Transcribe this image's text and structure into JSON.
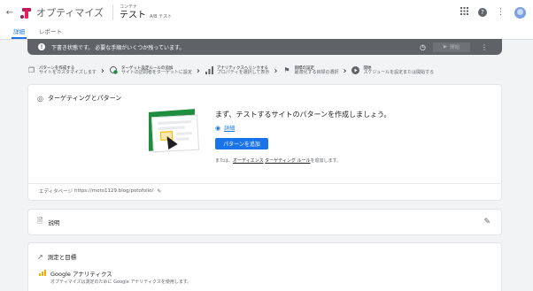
{
  "header": {
    "brand": "オプティマイズ",
    "container_label": "コンテナ",
    "container_name": "テスト",
    "experiment_type": "A/B テスト"
  },
  "tabs": [
    {
      "label": "詳細",
      "active": true
    },
    {
      "label": "レポート",
      "active": false
    }
  ],
  "banner": {
    "text": "下書き状態です。 必要な手順がいくつか残っています。",
    "start_label": "開始"
  },
  "steps": [
    {
      "title": "パターンを作成する",
      "subtitle": "サイトをカスタマイズします",
      "icon": "copy-icon"
    },
    {
      "title": "ターゲット設定ルールの追加",
      "subtitle": "サイトの訪問者をターゲットに設定",
      "icon": "target-check-icon"
    },
    {
      "title": "アナリティクスへリンクする",
      "subtitle": "プロパティを選択して表示",
      "icon": "analytics-icon"
    },
    {
      "title": "目標の設定",
      "subtitle": "最適化する目標の選択",
      "icon": "flag-icon"
    },
    {
      "title": "開始",
      "subtitle": "スケジュールを設定または開始する",
      "icon": "play-icon"
    }
  ],
  "targeting": {
    "title": "ターゲティングとパターン",
    "heading": "まず、テストするサイトのパターンを作成しましょう。",
    "details_link": "詳細",
    "add_button": "パターンを追加",
    "alt_prefix": "または、",
    "alt_rule1": "オーディエンス",
    "alt_rule2": "ターゲティング ルール",
    "alt_suffix": "を追加します。",
    "editor_label": "エディタページ",
    "editor_url": "https://moto1129.blog/potofolio/"
  },
  "description": {
    "title": "説明"
  },
  "measurement": {
    "title": "測定と目標",
    "ga_title": "Google アナリティクス",
    "ga_subtitle": "オプティマイズは測定のために Google アナリティクスを使用します。"
  },
  "colors": {
    "accent": "#1a73e8",
    "banner": "#5f6368",
    "logo_magenta": "#c2185b"
  }
}
